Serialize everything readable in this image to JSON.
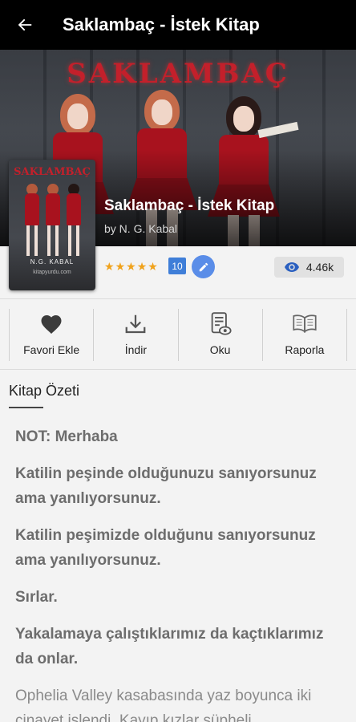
{
  "header": {
    "title": "Saklambaç - İstek Kitap",
    "back_icon": "arrow-left-icon"
  },
  "hero": {
    "banner_text": "SAKLAMBAÇ"
  },
  "cover": {
    "title": "SAKLAMBAÇ",
    "author": "N.G. KABAL",
    "site": "kitapyurdu.com"
  },
  "book": {
    "title": "Saklambaç - İstek Kitap",
    "author": "by N. G. Kabal",
    "rating_stars": 5,
    "rating_badge": "10",
    "views": "4.46k"
  },
  "actions": [
    {
      "label": "Favori Ekle",
      "icon": "heart-icon"
    },
    {
      "label": "İndir",
      "icon": "download-icon"
    },
    {
      "label": "Oku",
      "icon": "read-document-icon"
    },
    {
      "label": "Raporla",
      "icon": "open-book-icon"
    }
  ],
  "summary": {
    "heading": "Kitap Özeti",
    "paragraphs": [
      "NOT: Merhaba",
      "Katilin peşinde olduğunuzu sanıyorsunuz ama yanılıyorsunuz.",
      "Katilin peşimizde olduğunu sanıyorsunuz ama yanılıyorsunuz.",
      "Sırlar.",
      "Yakalamaya çalıştıklarımız da kaçtıklarımız da onlar.",
      "Ophelia Valley kasabasında yaz boyunca iki cinayet işlendi. Kayıp kızlar şüpheli"
    ]
  },
  "colors": {
    "accent": "#3f7ed8",
    "star": "#f0a21b",
    "topbar": "#000000"
  }
}
